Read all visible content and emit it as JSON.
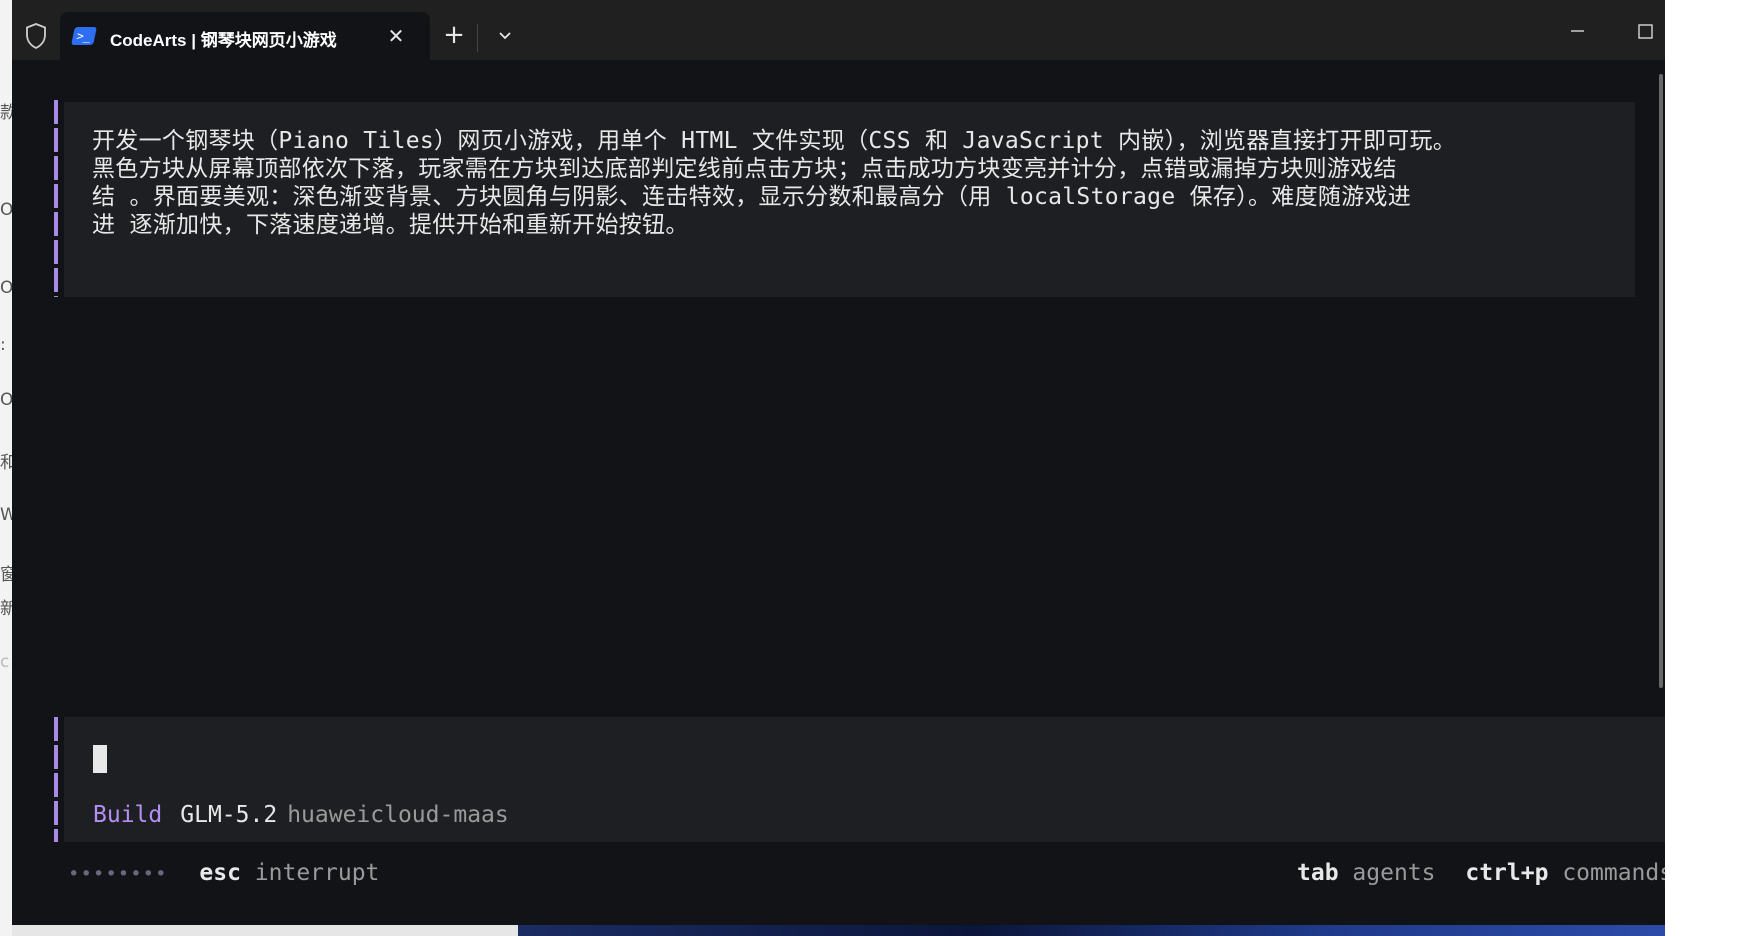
{
  "desktop": {
    "left_edge_glyphs": [
      "款",
      "O",
      "O:",
      ":",
      "O:",
      "和",
      "W",
      "窗",
      "新",
      "c"
    ]
  },
  "tab": {
    "title": "CodeArts | 钢琴块网页小游戏",
    "icon": "powershell-icon"
  },
  "toolbar": {
    "new_tab_icon": "plus-icon",
    "dropdown_icon": "chevron-down-icon"
  },
  "window_controls": {
    "minimize_icon": "minimize-icon",
    "maximize_icon": "maximize-icon"
  },
  "prompt": {
    "lines": [
      "开发一个钢琴块（Piano Tiles）网页小游戏，用单个 HTML 文件实现（CSS 和 JavaScript 内嵌），浏览器直接打开即可玩。",
      "黑色方块从屏幕顶部依次下落，玩家需在方块到达底部判定线前点击方块；点击成功方块变亮并计分，点错或漏掉方块则游戏结",
      "结 。界面要美观：深色渐变背景、方块圆角与阴影、连击特效，显示分数和最高分（用 localStorage 保存）。难度随游戏进",
      "进 逐渐加快，下落速度递增。提供开始和重新开始按钮。"
    ]
  },
  "input": {
    "agent": "Build",
    "model": "GLM-5.2",
    "provider": "huaweicloud-maas"
  },
  "status": {
    "progress_dots": "••••••••",
    "interrupt_key": "esc",
    "interrupt_label": "interrupt",
    "agents_key": "tab",
    "agents_label": "agents",
    "commands_key": "ctrl+p",
    "commands_label": "commands"
  },
  "colors": {
    "accent": "#b48ef2",
    "terminal_bg": "#111316",
    "block_bg": "#1d1f22",
    "titlebar_bg": "#202020"
  }
}
